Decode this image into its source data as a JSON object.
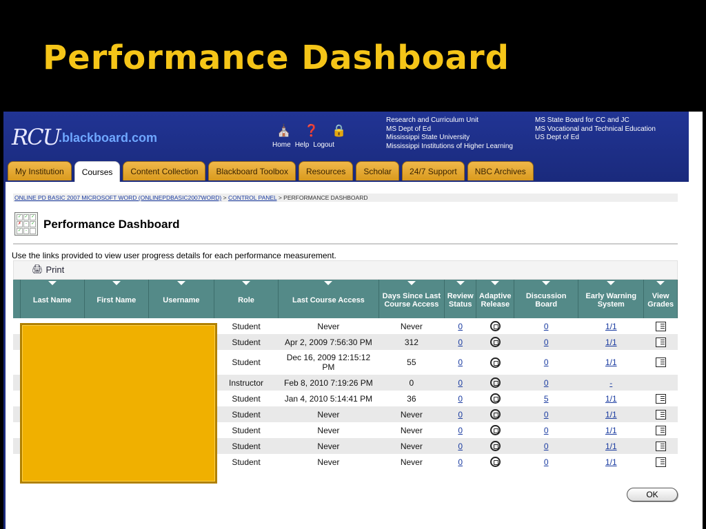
{
  "slide": {
    "title": "Performance Dashboard"
  },
  "header": {
    "logo_rc": "RCU",
    "logo_bb": ".blackboard.com",
    "links": [
      "Home",
      "Help",
      "Logout"
    ],
    "info_col1": [
      "Research and Curriculum Unit",
      "MS Dept of Ed",
      "Mississippi State University",
      "Mississippi Institutions of Higher Learning"
    ],
    "info_col2": [
      "MS State Board for CC and JC",
      "MS Vocational and Technical Education",
      "US Dept of Ed"
    ]
  },
  "tabs": [
    {
      "label": "My Institution",
      "active": false
    },
    {
      "label": "Courses",
      "active": true
    },
    {
      "label": "Content Collection",
      "active": false
    },
    {
      "label": "Blackboard Toolbox",
      "active": false
    },
    {
      "label": "Resources",
      "active": false
    },
    {
      "label": "Scholar",
      "active": false
    },
    {
      "label": "24/7 Support",
      "active": false
    },
    {
      "label": "NBC Archives",
      "active": false
    }
  ],
  "breadcrumb": {
    "course": "ONLINE PD BASIC 2007 MICROSOFT WORD (ONLINEPDBASIC2007WORD)",
    "sep1": " > ",
    "panel": "CONTROL PANEL",
    "sep2": " > ",
    "current": "PERFORMANCE DASHBOARD"
  },
  "page": {
    "title": "Performance Dashboard",
    "intro": "Use the links provided to view user progress details for each performance measurement.",
    "print_label": "Print",
    "ok_label": "OK"
  },
  "table": {
    "headers": [
      "Last Name",
      "First Name",
      "Username",
      "Role",
      "Last Course Access",
      "Days Since Last Course Access",
      "Review Status",
      "Adaptive Release",
      "Discussion Board",
      "Early Warning System",
      "View Grades"
    ],
    "rows": [
      {
        "role": "Student",
        "access": "Never",
        "days": "Never",
        "review": "0",
        "discussion": "0",
        "ews": "1/1",
        "grades": true
      },
      {
        "role": "Student",
        "access": "Apr 2, 2009 7:56:30 PM",
        "days": "312",
        "review": "0",
        "discussion": "0",
        "ews": "1/1",
        "grades": true
      },
      {
        "role": "Student",
        "access": "Dec 16, 2009 12:15:12 PM",
        "days": "55",
        "review": "0",
        "discussion": "0",
        "ews": "1/1",
        "grades": true
      },
      {
        "role": "Instructor",
        "access": "Feb 8, 2010 7:19:26 PM",
        "days": "0",
        "review": "0",
        "discussion": "0",
        "ews": "-",
        "grades": false
      },
      {
        "role": "Student",
        "access": "Jan 4, 2010 5:14:41 PM",
        "days": "36",
        "review": "0",
        "discussion": "5",
        "ews": "1/1",
        "grades": true
      },
      {
        "role": "Student",
        "access": "Never",
        "days": "Never",
        "review": "0",
        "discussion": "0",
        "ews": "1/1",
        "grades": true
      },
      {
        "role": "Student",
        "access": "Never",
        "days": "Never",
        "review": "0",
        "discussion": "0",
        "ews": "1/1",
        "grades": true
      },
      {
        "role": "Student",
        "access": "Never",
        "days": "Never",
        "review": "0",
        "discussion": "0",
        "ews": "1/1",
        "grades": true
      },
      {
        "role": "Student",
        "access": "Never",
        "days": "Never",
        "review": "0",
        "discussion": "0",
        "ews": "1/1",
        "grades": true
      }
    ]
  },
  "colors": {
    "header_bg": "#1a2a7c",
    "tab_bg": "#e6a830",
    "table_header": "#548a88",
    "redaction": "#f0b000",
    "slide_title": "#f5c518"
  }
}
